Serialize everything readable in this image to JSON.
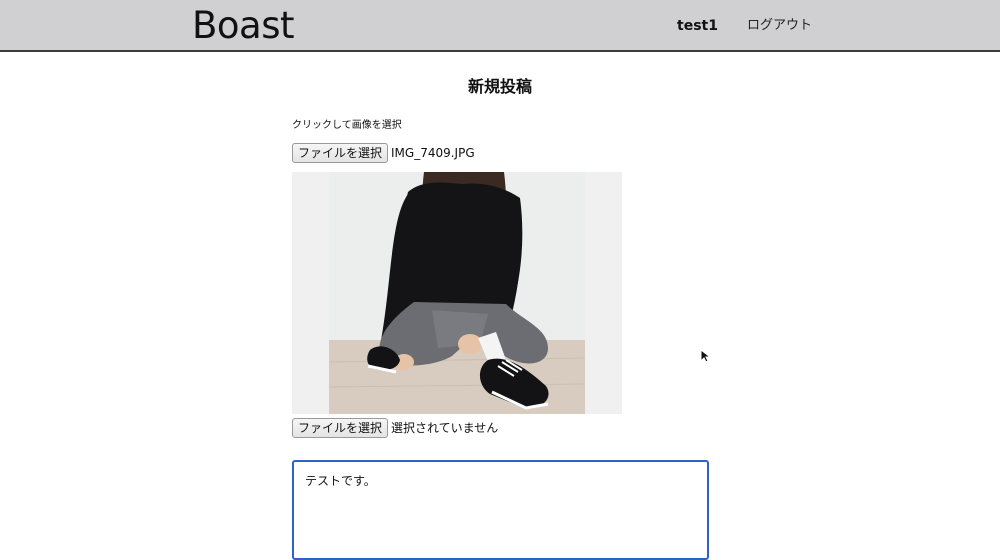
{
  "header": {
    "logo": "Boast",
    "user": "test1",
    "logout": "ログアウト"
  },
  "page": {
    "title": "新規投稿"
  },
  "form": {
    "hint": "クリックして画像を選択",
    "file1": {
      "button": "ファイルを選択",
      "filename": "IMG_7409.JPG"
    },
    "file2": {
      "button": "ファイルを選択",
      "filename": "選択されていません"
    },
    "textarea_value": "テストです。"
  },
  "icons": {
    "cursor": "mouse-pointer-icon"
  },
  "colors": {
    "header_bg": "#d0cfd1",
    "focus_border": "#2d63c8"
  }
}
